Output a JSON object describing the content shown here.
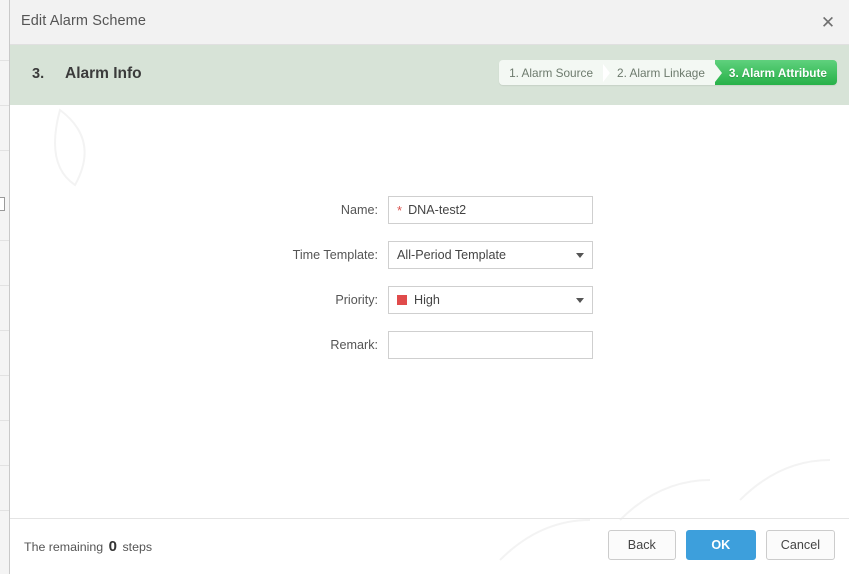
{
  "window": {
    "title": "Edit Alarm Scheme",
    "close_icon": "close-icon"
  },
  "step_banner": {
    "number": "3.",
    "title": "Alarm Info",
    "steps": [
      {
        "label": "1. Alarm Source",
        "active": false
      },
      {
        "label": "2. Alarm Linkage",
        "active": false
      },
      {
        "label": "3. Alarm Attribute",
        "active": true
      }
    ]
  },
  "form": {
    "name": {
      "label": "Name:",
      "required_marker": "*",
      "value": "DNA-test2",
      "placeholder": ""
    },
    "time_template": {
      "label": "Time Template:",
      "value": "All-Period Template"
    },
    "priority": {
      "label": "Priority:",
      "value": "High",
      "swatch_color": "#e04b4b"
    },
    "remark": {
      "label": "Remark:",
      "value": "",
      "placeholder": ""
    }
  },
  "footer": {
    "remaining_prefix": "The remaining",
    "remaining_count": "0",
    "remaining_suffix": "steps",
    "back_label": "Back",
    "ok_label": "OK",
    "cancel_label": "Cancel"
  },
  "colors": {
    "accent_blue": "#3d9fdc",
    "active_step_green": "#27b148",
    "banner_green": "#d7e3d7",
    "priority_red": "#e04b4b"
  }
}
